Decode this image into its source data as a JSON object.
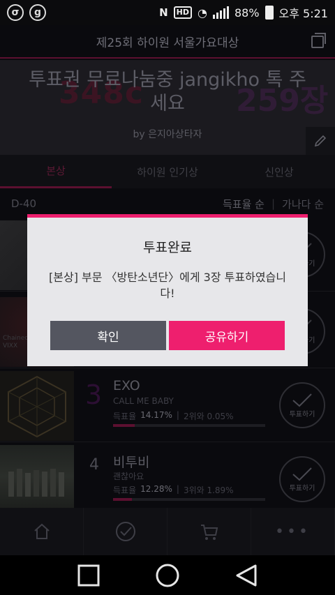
{
  "status_bar": {
    "left_icons": [
      "ollehtv-icon",
      "g-icon"
    ],
    "hd_badge": "HD",
    "battery": "88%",
    "time": "오후 5:21"
  },
  "header": {
    "title": "제25회 하이원 서울가요대상"
  },
  "hero": {
    "text": "투표권 무료나눔중 jangikho 톡 주세요",
    "by": "by 은지아상타자",
    "bg_left": "348c",
    "bg_right": "259장"
  },
  "tabs": [
    "본상",
    "하이원 인기상",
    "신인상"
  ],
  "list_header": {
    "dday": "D-40",
    "sort_active": "득표율 순",
    "sort_other": "가나다 순"
  },
  "rows": [
    {
      "rank": "3",
      "artist": "EXO",
      "song": "CALL ME BABY",
      "rate_label": "득표율",
      "rate": "14.17%",
      "diff": "2위와 0.05%",
      "fill": 14.17,
      "vote_label": "투표하기"
    },
    {
      "rank": "4",
      "artist": "비투비",
      "song": "괜찮아요",
      "rate_label": "득표율",
      "rate": "12.28%",
      "diff": "3위와 1.89%",
      "fill": 12.28,
      "vote_label": "투표하기"
    }
  ],
  "partial_vote_label": "투표하기",
  "thumb2_text": [
    "Chained up",
    "VIXX"
  ],
  "modal": {
    "title": "투표완료",
    "message": "[본상] 부문 〈방탄소년단〉에게 3장 투표하였습니다!",
    "ok_label": "확인",
    "share_label": "공유하기"
  },
  "colors": {
    "accent": "#ee1f6e",
    "ok_button": "#545660",
    "dialog_bg": "#e7e7ea"
  }
}
